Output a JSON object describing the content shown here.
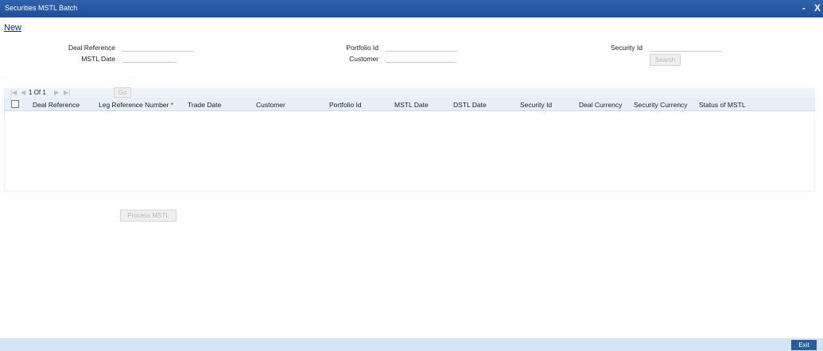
{
  "window": {
    "title": "Securities MSTL Batch",
    "minimize_glyph": "-",
    "close_glyph": "X"
  },
  "menu": {
    "new_label": "New"
  },
  "form": {
    "deal_reference_label": "Deal Reference",
    "mstl_date_label": "MSTL Date",
    "portfolio_id_label": "Portfolio Id",
    "customer_label": "Customer",
    "security_id_label": "Security Id",
    "search_label": "Search",
    "deal_reference_value": "",
    "mstl_date_value": "",
    "portfolio_id_value": "",
    "customer_value": "",
    "security_id_value": ""
  },
  "pager": {
    "first_glyph": "|◀",
    "prev_glyph": "◀",
    "page_text": "1 Of 1",
    "next_glyph": "▶",
    "last_glyph": "▶|",
    "go_label": "Go"
  },
  "grid": {
    "columns": [
      "Deal Reference",
      "Leg Reference Number",
      "Trade Date",
      "Customer",
      "Portfolio Id",
      "MSTL Date",
      "DSTL Date",
      "Security Id",
      "Deal Currency",
      "Security Currency",
      "Status of MSTL"
    ],
    "required_marker": "*",
    "rows": []
  },
  "actions": {
    "process_label": "Process MSTL",
    "exit_label": "Exit"
  },
  "colors": {
    "titlebar": "#1e4f9a",
    "header_bg": "#e7eff8",
    "footer_bg": "#d4e4f5",
    "exit_bg": "#2a5d9f"
  }
}
